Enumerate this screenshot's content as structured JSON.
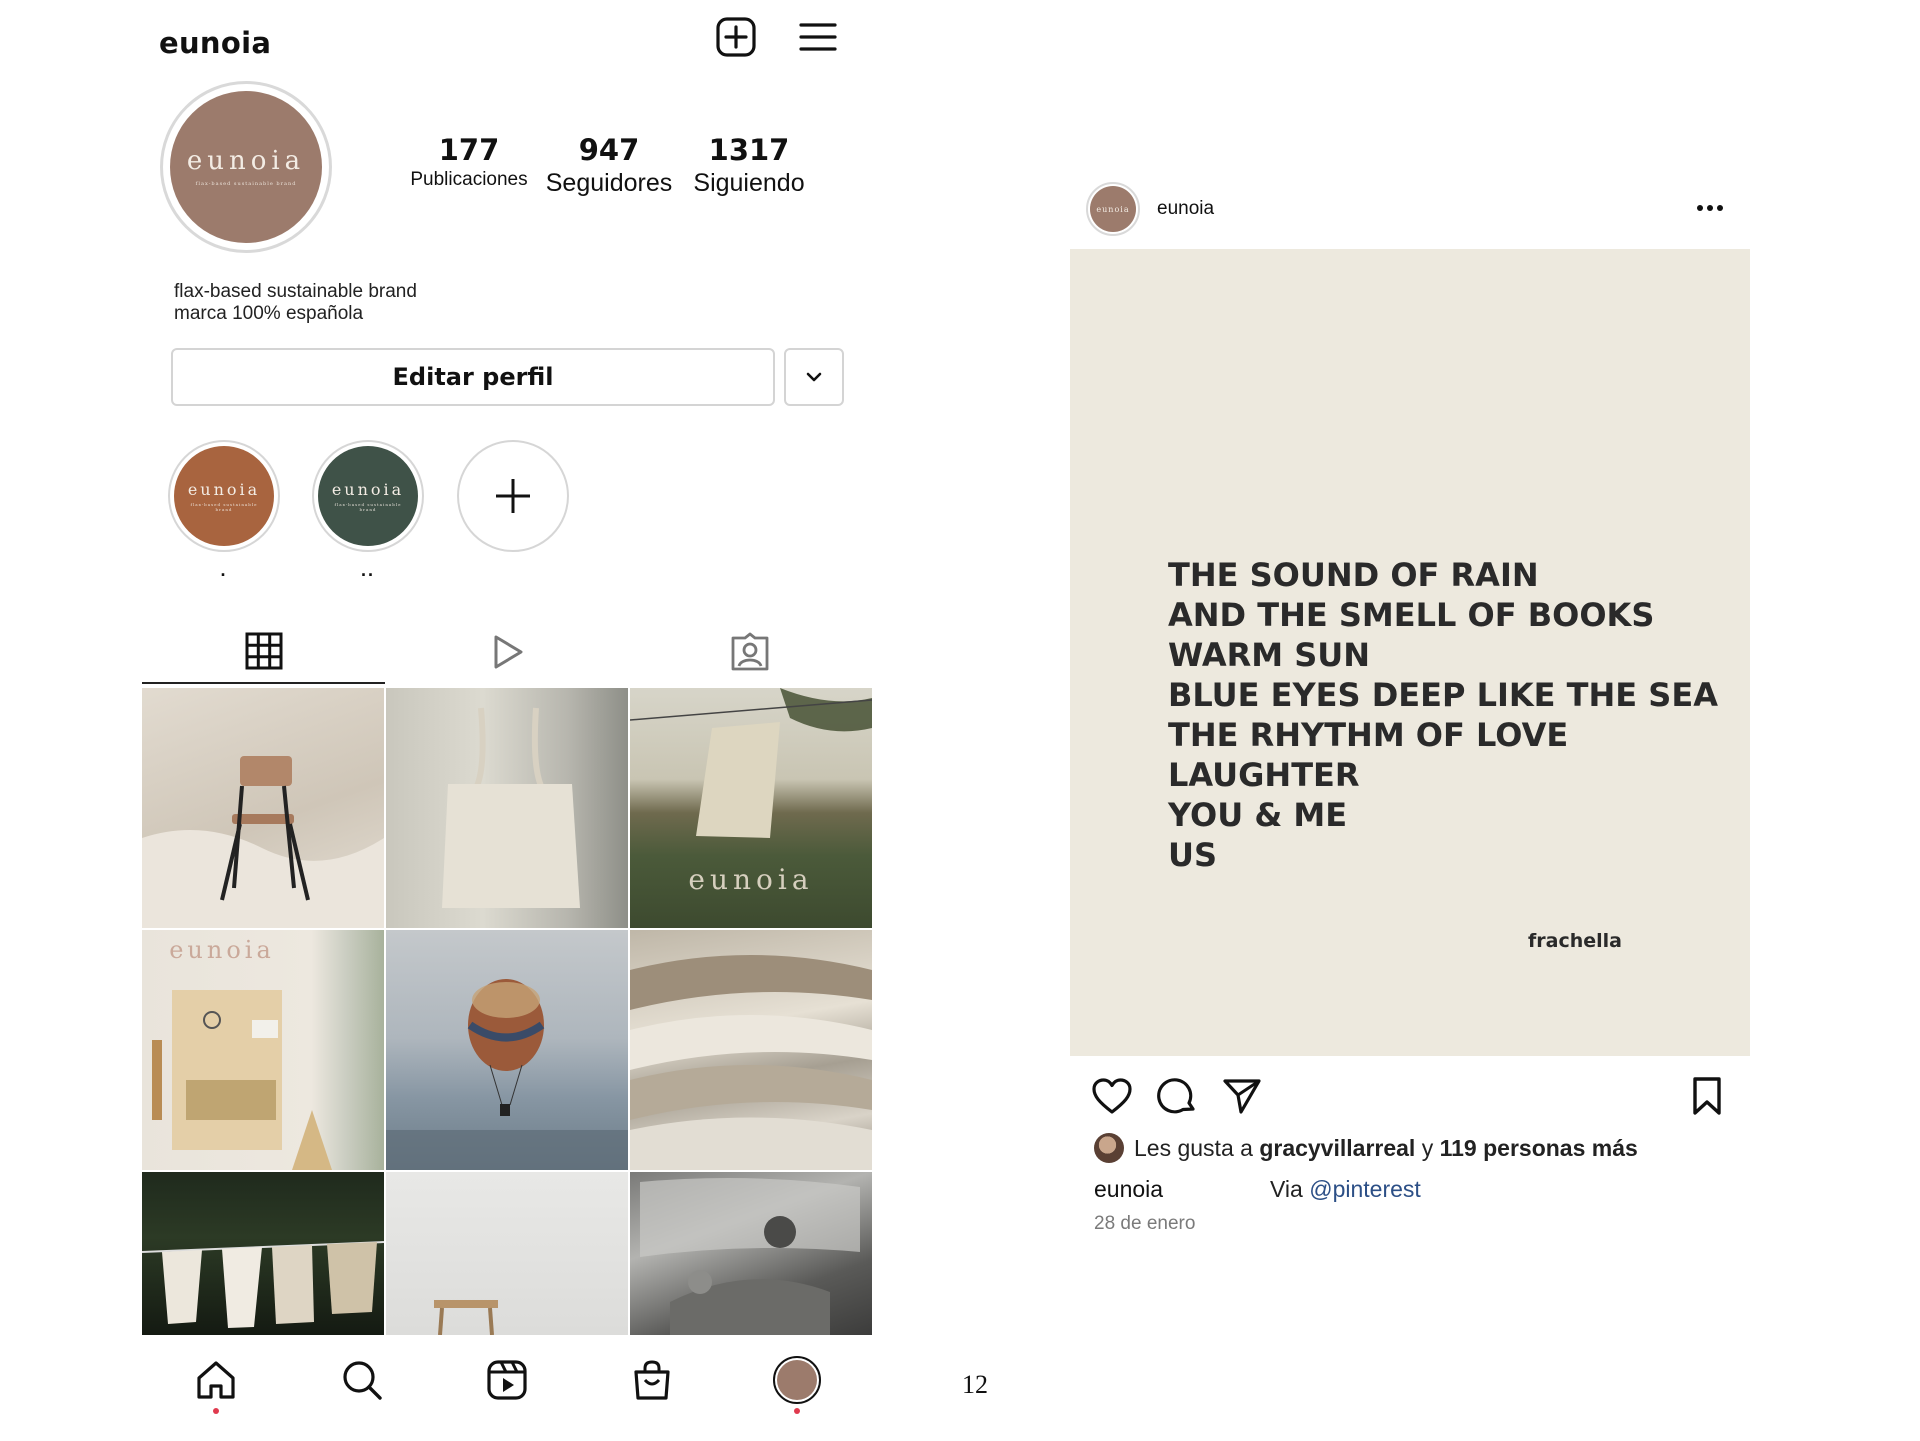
{
  "profile": {
    "username": "eunoia",
    "logo": {
      "word": "eunoia",
      "tagline": "flax-based sustainable brand",
      "color": "#9c7b6c"
    },
    "stats": {
      "posts_count": "177",
      "posts_label": "Publicaciones",
      "followers_count": "947",
      "followers_label": "Seguidores",
      "following_count": "1317",
      "following_label": "Siguiendo"
    },
    "bio_line1": "flax-based sustainable brand",
    "bio_line2": "marca 100% española",
    "edit_button": "Editar perfil",
    "highlights": [
      {
        "label": ".",
        "color": "#a8643f"
      },
      {
        "label": "..",
        "color": "#3f5248"
      }
    ],
    "tabs": [
      "grid-icon",
      "reels-icon",
      "tagged-icon"
    ],
    "grid_overlay_text": {
      "post3": "eunoia",
      "post4": "eunoia"
    },
    "nav_icons": [
      "home-icon",
      "search-icon",
      "reels-icon",
      "shop-icon",
      "profile-avatar"
    ]
  },
  "page_number": "12",
  "post": {
    "username": "eunoia",
    "quote_lines": [
      "THE SOUND OF RAIN",
      "AND THE SMELL OF BOOKS",
      "WARM SUN",
      "BLUE EYES DEEP LIKE THE SEA",
      "THE RHYTHM OF LOVE",
      "LAUGHTER",
      "YOU & ME",
      "US"
    ],
    "quote_author": "frachella",
    "likes_prefix": "Les gusta a ",
    "liker": "gracyvillarreal",
    "likes_mid": " y ",
    "likes_rest": "119 personas más",
    "caption_user": "eunoia",
    "caption_via": "Via ",
    "caption_link": "@pinterest",
    "date": "28 de enero",
    "image_bg": "#ede9de"
  },
  "colors": {
    "link": "#2c4f86",
    "notification_dot": "#e03a4e"
  }
}
